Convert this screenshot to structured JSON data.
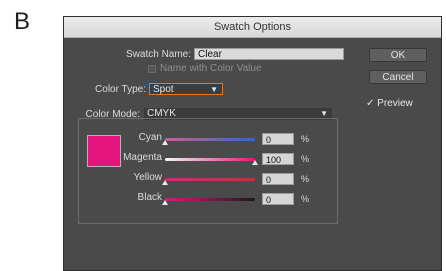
{
  "panel_letter": "B",
  "window": {
    "title": "Swatch Options"
  },
  "form": {
    "swatch_name_label": "Swatch Name:",
    "swatch_name_value": "Clear",
    "name_with_color_value_label": "Name with Color Value",
    "color_type_label": "Color Type:",
    "color_type_value": "Spot",
    "color_mode_label": "Color Mode:",
    "color_mode_value": "CMYK"
  },
  "buttons": {
    "ok": "OK",
    "cancel": "Cancel"
  },
  "preview": {
    "checkmark": "✓",
    "label": "Preview"
  },
  "swatch_color": "#e3157d",
  "sliders": [
    {
      "label": "Cyan",
      "value": "0",
      "unit": "%",
      "fraction": 0.0
    },
    {
      "label": "Magenta",
      "value": "100",
      "unit": "%",
      "fraction": 1.0
    },
    {
      "label": "Yellow",
      "value": "0",
      "unit": "%",
      "fraction": 0.0
    },
    {
      "label": "Black",
      "value": "0",
      "unit": "%",
      "fraction": 0.0
    }
  ],
  "colors": {
    "dialog_bg": "#4a4a4a",
    "accent_orange": "#e07a2b",
    "magenta": "#e3157d"
  },
  "icons": {
    "dropdown": "chevron-down-icon",
    "preview_check": "checkmark-icon"
  }
}
